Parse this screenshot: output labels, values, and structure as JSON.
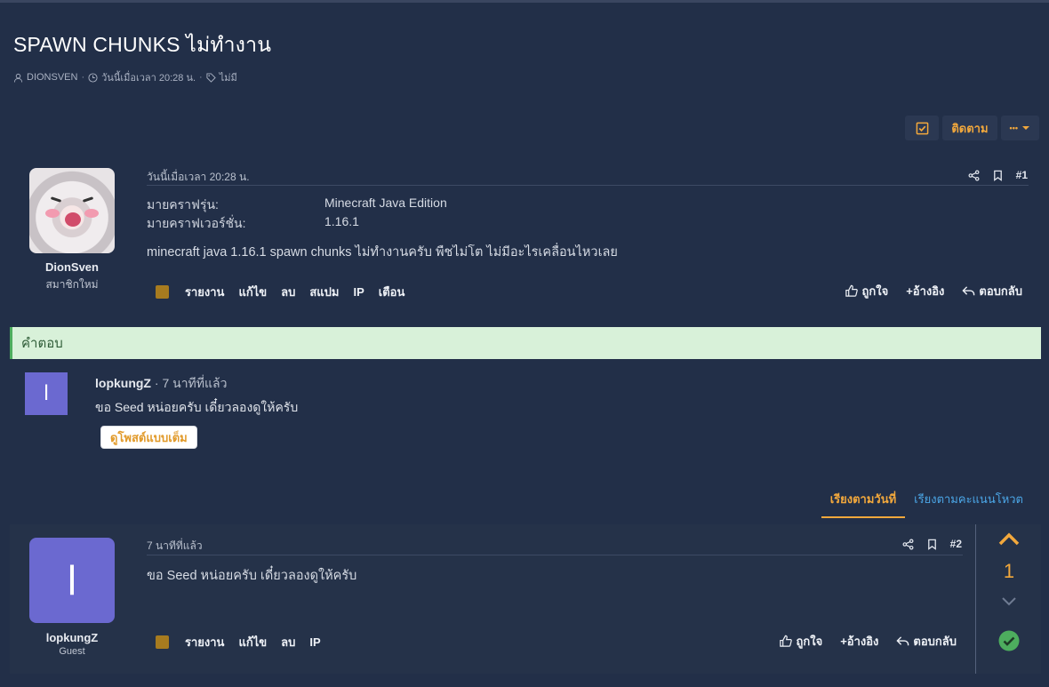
{
  "thread": {
    "title": "SPAWN CHUNKS ไม่ทำงาน",
    "author": "DIONSVEN",
    "date": "วันนี้เมื่อเวลา 20:28 น.",
    "tags": "ไม่มี",
    "follow_label": "ติดตาม",
    "more_label": "•••"
  },
  "post1": {
    "date": "วันนี้เมื่อเวลา 20:28 น.",
    "number": "#1",
    "user_name": "DionSven",
    "user_title": "สมาชิกใหม่",
    "fields": [
      {
        "label": "มายคราฟรุ่น:",
        "value": "Minecraft Java Edition"
      },
      {
        "label": "มายคราฟเวอร์ชั่น:",
        "value": "1.16.1"
      }
    ],
    "body": "minecraft java 1.16.1 spawn chunks ไม่ทำงานครับ พืชไม่โต ไม่มีอะไรเคลื่อนไหวเลย",
    "actions": [
      "รายงาน",
      "แก้ไข",
      "ลบ",
      "สแปม",
      "IP",
      "เตือน"
    ],
    "reactions": {
      "like": "ถูกใจ",
      "quote": "+อ้างอิง",
      "reply": "ตอบกลับ"
    }
  },
  "answer": {
    "banner": "คำตอบ",
    "avatar_letter": "l",
    "user_name": "lopkungZ",
    "time": "· 7 นาทีที่แล้ว",
    "text": "ขอ Seed หน่อยครับ เดี๋ยวลองดูให้ครับ",
    "full_post_label": "ดูโพสต์แบบเต็ม"
  },
  "sort": {
    "by_date": "เรียงตามวันที่",
    "by_votes": "เรียงตามคะแนนโหวต"
  },
  "post2": {
    "date": "7 นาทีที่แล้ว",
    "number": "#2",
    "avatar_letter": "l",
    "user_name": "lopkungZ",
    "user_title": "Guest",
    "body": "ขอ Seed หน่อยครับ เดี๋ยวลองดูให้ครับ",
    "actions": [
      "รายงาน",
      "แก้ไข",
      "ลบ",
      "IP"
    ],
    "reactions": {
      "like": "ถูกใจ",
      "quote": "+อ้างอิง",
      "reply": "ตอบกลับ"
    },
    "vote_count": "1"
  },
  "colors": {
    "accent": "#f2a83c",
    "background": "#222f48",
    "avatar": "#6b69d0",
    "solution": "#4dad5e"
  }
}
